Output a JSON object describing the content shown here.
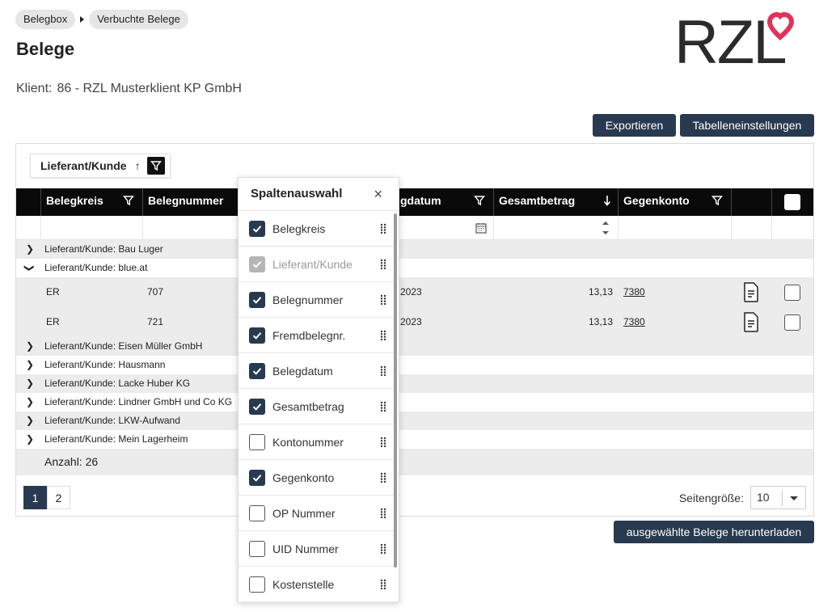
{
  "breadcrumb": [
    "Belegbox",
    "Verbuchte Belege"
  ],
  "page_title": "Belege",
  "client": {
    "label": "Klient:",
    "value": "86 - RZL Musterklient KP GmbH"
  },
  "logo": {
    "text": "RZL",
    "accent": "#e0335a"
  },
  "colors": {
    "navy": "#283a4f",
    "header_black": "#0a0a0a",
    "row_grey": "#ececec"
  },
  "actions": {
    "export": "Exportieren",
    "table_settings": "Tabelleneinstellungen",
    "download": "ausgewählte Belege herunterladen"
  },
  "group_chip": {
    "label": "Lieferant/Kunde",
    "sort": "↑"
  },
  "columns": {
    "c1": "Belegkreis",
    "c2": "Belegnummer",
    "c3": "gdatum",
    "c4": "Gesamtbetrag",
    "c5": "Gegenkonto"
  },
  "groups": [
    {
      "label": "Lieferant/Kunde: Bau Luger",
      "expanded": false
    },
    {
      "label": "Lieferant/Kunde: blue.at",
      "expanded": true
    },
    {
      "label": "Lieferant/Kunde: Eisen Müller GmbH",
      "expanded": false
    },
    {
      "label": "Lieferant/Kunde: Hausmann",
      "expanded": false
    },
    {
      "label": "Lieferant/Kunde: Lacke Huber KG",
      "expanded": false
    },
    {
      "label": "Lieferant/Kunde: Lindner GmbH und Co KG",
      "expanded": false
    },
    {
      "label": "Lieferant/Kunde: LKW-Aufwand",
      "expanded": false
    },
    {
      "label": "Lieferant/Kunde: Mein Lagerheim",
      "expanded": false
    }
  ],
  "rows": [
    {
      "kreis": "ER",
      "nummer": "707",
      "datum": "2023",
      "betrag": "13,13",
      "konto": "7380"
    },
    {
      "kreis": "ER",
      "nummer": "721",
      "datum": "2023",
      "betrag": "13,13",
      "konto": "7380"
    }
  ],
  "footer": {
    "count_label": "Anzahl: 26"
  },
  "pagination": {
    "pages": [
      "1",
      "2"
    ],
    "active": "1",
    "page_size_label": "Seitengröße:",
    "page_size": "10"
  },
  "picker": {
    "title": "Spaltenauswahl",
    "close": "×",
    "items": [
      {
        "label": "Belegkreis",
        "state": "on"
      },
      {
        "label": "Lieferant/Kunde",
        "state": "disabled"
      },
      {
        "label": "Belegnummer",
        "state": "on"
      },
      {
        "label": "Fremdbelegnr.",
        "state": "on"
      },
      {
        "label": "Belegdatum",
        "state": "on"
      },
      {
        "label": "Gesamtbetrag",
        "state": "on"
      },
      {
        "label": "Kontonummer",
        "state": "off"
      },
      {
        "label": "Gegenkonto",
        "state": "on"
      },
      {
        "label": "OP Nummer",
        "state": "off"
      },
      {
        "label": "UID Nummer",
        "state": "off"
      },
      {
        "label": "Kostenstelle",
        "state": "off"
      }
    ]
  }
}
